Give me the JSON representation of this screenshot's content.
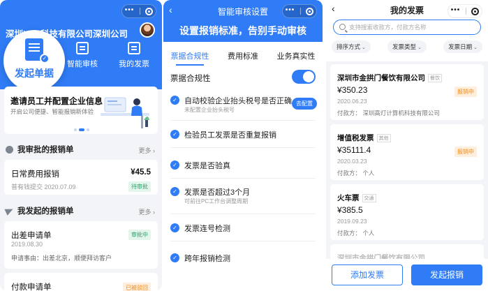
{
  "brand_color": "#2f7cf6",
  "screen1": {
    "company": "深圳XXX科技有限公司深圳公司",
    "launch_label": "发起单据",
    "quick_actions": [
      {
        "label": "智能审核",
        "icon": "audit-icon"
      },
      {
        "label": "我的发票",
        "icon": "invoice-icon"
      }
    ],
    "banner": {
      "title": "邀请员工并配置企业信息",
      "subtitle": "开启公司便捷、智能报销新体验"
    },
    "approve_section": {
      "title": "我审批的报销单",
      "more": "更多"
    },
    "approve_item": {
      "title": "日常费用报销",
      "amount": "¥45.5",
      "meta": "普有钱提交  2020.07.09",
      "status": "待审批"
    },
    "my_section": {
      "title": "我发起的报销单",
      "more": "更多"
    },
    "my_item": {
      "title": "出差申请单",
      "date": "2019.08.30",
      "reason": "申请事由：出差北京，顺便拜访客户",
      "status": "审批中"
    },
    "my_item2": {
      "title": "付款申请单",
      "status": "已被驳回"
    }
  },
  "screen2": {
    "title": "智能审核设置",
    "slogan": "设置报销标准，告别手动审核",
    "tabs": [
      "票据合规性",
      "费用标准",
      "业务真实性"
    ],
    "toggle_label": "票据合规性",
    "rules": [
      {
        "title": "自动校验企业抬头税号是否正确",
        "sub": "未配置企业抬头税号",
        "button": "去配置"
      },
      {
        "title": "检验员工发票是否重复报销",
        "sub": "",
        "button": ""
      },
      {
        "title": "发票是否验真",
        "sub": "",
        "button": ""
      },
      {
        "title": "发票是否超过3个月",
        "sub": "可前往PC工作台调整周期",
        "button": ""
      },
      {
        "title": "发票连号检测",
        "sub": "",
        "button": ""
      },
      {
        "title": "跨年报销检测",
        "sub": "",
        "button": ""
      }
    ]
  },
  "screen3": {
    "title": "我的发票",
    "search_placeholder": "支持搜索收款方，付款方名称",
    "filters": [
      "排序方式",
      "发票类型",
      "发票日期"
    ],
    "invoices": [
      {
        "name": "深圳市金拱门餐饮有限公司",
        "tag": "餐饮",
        "amount": "¥350.23",
        "date": "2020.06.23",
        "payer": "付款方：  深圳高灯计算机科技有限公司",
        "status": "报销中"
      },
      {
        "name": "增值税发票",
        "tag": "其他",
        "amount": "¥35111.4",
        "date": "2020.03.23",
        "payer": "付款方：  个人",
        "status": "报销中"
      },
      {
        "name": "火车票",
        "tag": "交通",
        "amount": "¥385.5",
        "date": "2019.09.23",
        "payer": "付款方：  个人",
        "status": ""
      }
    ],
    "partial_invoice": "深圳市金拱门餐饮有限公司",
    "add_button": "添加发票",
    "launch_button": "发起报销"
  }
}
